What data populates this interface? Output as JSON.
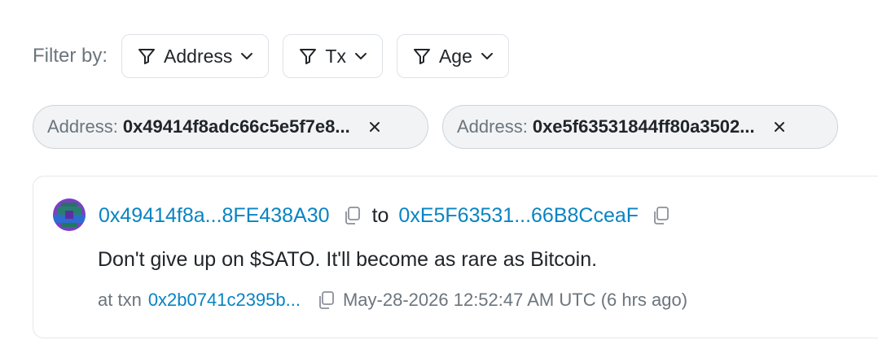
{
  "filters": {
    "label": "Filter by:",
    "buttons": [
      {
        "label": "Address"
      },
      {
        "label": "Tx"
      },
      {
        "label": "Age"
      }
    ]
  },
  "active_filters": [
    {
      "label": "Address:",
      "value": "0x49414f8adc66c5e5f7e8..."
    },
    {
      "label": "Address:",
      "value": "0xe5f63531844ff80a3502..."
    }
  ],
  "message": {
    "from": "0x49414f8a...8FE438A30",
    "to_label": "to",
    "to": "0xE5F63531...66B8CceaF",
    "text": "Don't give up on $SATO. It'll become as rare as Bitcoin.",
    "at_txn_label": "at txn",
    "txn": "0x2b0741c2395b...",
    "timestamp": "May-28-2026 12:52:47 AM UTC (6 hrs ago)"
  },
  "colors": {
    "link": "#0784c3",
    "muted": "#6c757d",
    "chip_bg": "#f1f3f5"
  }
}
